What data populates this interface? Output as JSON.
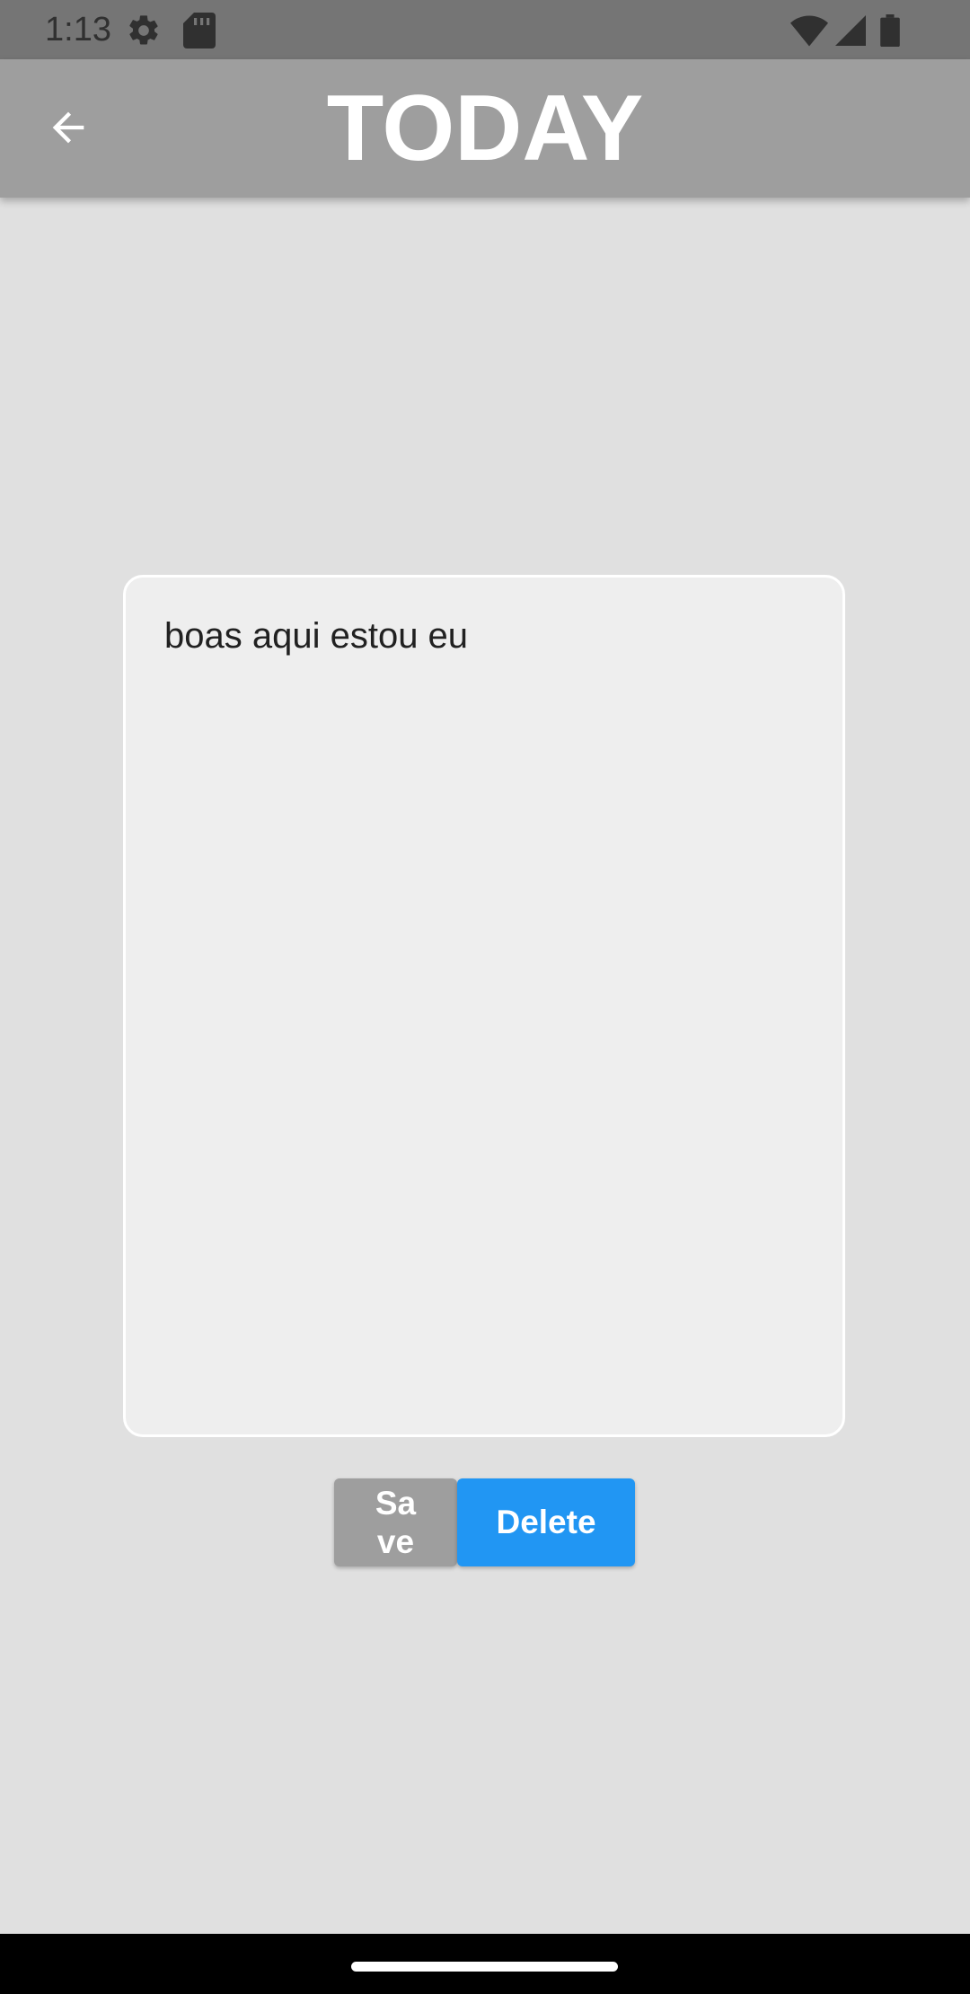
{
  "status_bar": {
    "time": "1:13",
    "left_icons": [
      "settings-icon",
      "sd-card-icon"
    ],
    "right_icons": [
      "wifi-icon",
      "signal-icon",
      "battery-icon"
    ]
  },
  "app_bar": {
    "back_icon": "arrow-back-icon",
    "title": "TODAY"
  },
  "note": {
    "text": "boas aqui estou eu"
  },
  "buttons": {
    "save_label": "Save",
    "delete_label": "Delete"
  },
  "colors": {
    "app_bar": "#9e9e9e",
    "background": "#e0e0e0",
    "save_button": "#9e9e9e",
    "delete_button": "#2196f3"
  }
}
